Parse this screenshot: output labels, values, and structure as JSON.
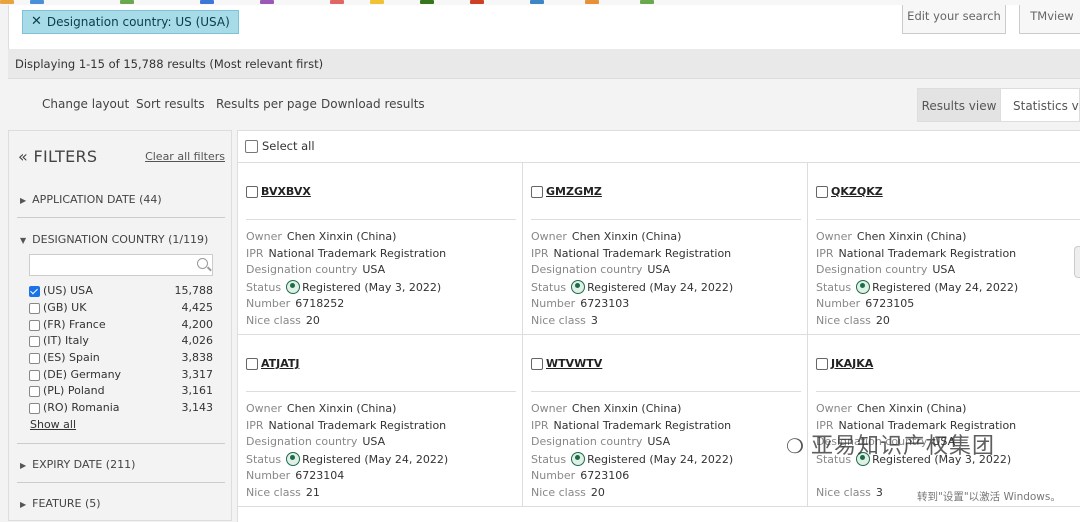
{
  "filter_chip": {
    "label": "Designation country: US (USA)"
  },
  "top_buttons": {
    "edit": "Edit your search",
    "tmview": "TMview"
  },
  "summary": "Displaying 1-15 of 15,788 results (Most relevant first)",
  "actions": [
    "Change layout",
    "Sort results",
    "Results per page",
    "Download results"
  ],
  "view_tabs": {
    "results": "Results view",
    "statistics": "Statistics view"
  },
  "sidebar": {
    "title": "FILTERS",
    "clear": "Clear all filters",
    "sections": {
      "application_date": "APPLICATION DATE (44)",
      "designation_country": "DESIGNATION COUNTRY (1/119)",
      "expiry_date": "EXPIRY DATE (211)",
      "feature": "FEATURE (5)"
    },
    "search_placeholder": "",
    "countries": [
      {
        "label": "(US) USA",
        "count": "15,788",
        "checked": true
      },
      {
        "label": "(GB) UK",
        "count": "4,425",
        "checked": false
      },
      {
        "label": "(FR) France",
        "count": "4,200",
        "checked": false
      },
      {
        "label": "(IT) Italy",
        "count": "4,026",
        "checked": false
      },
      {
        "label": "(ES) Spain",
        "count": "3,838",
        "checked": false
      },
      {
        "label": "(DE) Germany",
        "count": "3,317",
        "checked": false
      },
      {
        "label": "(PL) Poland",
        "count": "3,161",
        "checked": false
      },
      {
        "label": "(RO) Romania",
        "count": "3,143",
        "checked": false
      }
    ],
    "show_all": "Show all"
  },
  "results": {
    "select_all": "Select all",
    "labels": {
      "owner": "Owner",
      "ipr": "IPR",
      "country": "Designation country",
      "status": "Status",
      "number": "Number",
      "nice": "Nice class"
    },
    "cards": [
      {
        "mark": "BVXBVX",
        "owner": "Chen Xinxin (China)",
        "ipr": "National Trademark Registration",
        "country": "USA",
        "status": "Registered (May 3, 2022)",
        "number": "6718252",
        "nice": "20"
      },
      {
        "mark": "GMZGMZ",
        "owner": "Chen Xinxin (China)",
        "ipr": "National Trademark Registration",
        "country": "USA",
        "status": "Registered (May 24, 2022)",
        "number": "6723103",
        "nice": "3"
      },
      {
        "mark": "QKZQKZ",
        "owner": "Chen Xinxin (China)",
        "ipr": "National Trademark Registration",
        "country": "USA",
        "status": "Registered (May 24, 2022)",
        "number": "6723105",
        "nice": "20"
      },
      {
        "mark": "ATJATJ",
        "owner": "Chen Xinxin (China)",
        "ipr": "National Trademark Registration",
        "country": "USA",
        "status": "Registered (May 24, 2022)",
        "number": "6723104",
        "nice": "21"
      },
      {
        "mark": "WTVWTV",
        "owner": "Chen Xinxin (China)",
        "ipr": "National Trademark Registration",
        "country": "USA",
        "status": "Registered (May 24, 2022)",
        "number": "6723106",
        "nice": "20"
      },
      {
        "mark": "JKAJKA",
        "owner": "Chen Xinxin (China)",
        "ipr": "National Trademark Registration",
        "country": "USA",
        "status": "Registered (May 3, 2022)",
        "number": "",
        "nice": "3"
      }
    ]
  },
  "watermark": "亚易知识产权集团",
  "windows_notice": "转到\"设置\"以激活 Windows。"
}
